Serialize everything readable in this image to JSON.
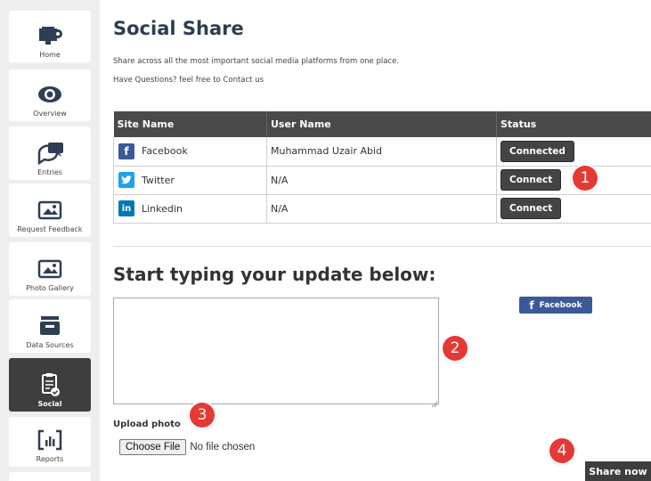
{
  "sidebar": {
    "items": [
      {
        "label": "Home",
        "icon": "home-gear-icon"
      },
      {
        "label": "Overview",
        "icon": "eye-icon"
      },
      {
        "label": "Entries",
        "icon": "chat-bubbles-icon"
      },
      {
        "label": "Request Feedback",
        "icon": "picture-icon"
      },
      {
        "label": "Photo Gallery",
        "icon": "picture-icon"
      },
      {
        "label": "Data Sources",
        "icon": "database-box-icon"
      },
      {
        "label": "Social",
        "icon": "clipboard-check-icon",
        "active": true
      },
      {
        "label": "Reports",
        "icon": "chart-icon"
      }
    ]
  },
  "main": {
    "title": "Social Share",
    "subtitle": "Share across all the most important social media platforms from one place.",
    "contact": "Have Questions? feel free to Contact us",
    "table": {
      "headers": [
        "Site Name",
        "User Name",
        "Status"
      ],
      "rows": [
        {
          "site": "Facebook",
          "icon_letter": "f",
          "color": "#3b5998",
          "user": "Muhammad Uzair Abid",
          "status": "Connected"
        },
        {
          "site": "Twitter",
          "icon_letter": "t",
          "color": "#1da1f2",
          "user": "N/A",
          "status": "Connect"
        },
        {
          "site": "Linkedin",
          "icon_letter": "in",
          "color": "#0077b5",
          "user": "N/A",
          "status": "Connect"
        }
      ]
    },
    "update_heading": "Start typing your update below:",
    "textarea_value": "",
    "facebook_share_label": "Facebook",
    "upload_label": "Upload photo",
    "choose_file_label": "Choose File",
    "file_status": "No file chosen",
    "share_button": "Share now"
  },
  "annotations": [
    "1",
    "2",
    "3",
    "4"
  ],
  "colors": {
    "accent_dark": "#3e3e3e",
    "marker_red": "#e53935",
    "facebook": "#3b5998"
  }
}
